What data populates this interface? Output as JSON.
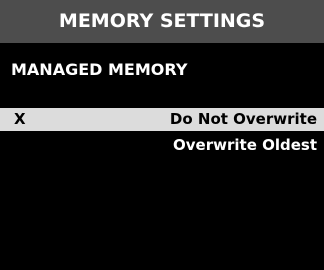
{
  "title": "MEMORY SETTINGS",
  "section_label": "MANAGED MEMORY",
  "options": [
    {
      "marker": "X",
      "label": "Do Not Overwrite",
      "selected": true
    },
    {
      "marker": "",
      "label": "Overwrite Oldest",
      "selected": false
    }
  ],
  "colors": {
    "title_background": "#4d4d4d",
    "screen_background": "#000000",
    "selected_background": "#dcdcdc",
    "text": "#ffffff",
    "selected_text": "#000000"
  }
}
